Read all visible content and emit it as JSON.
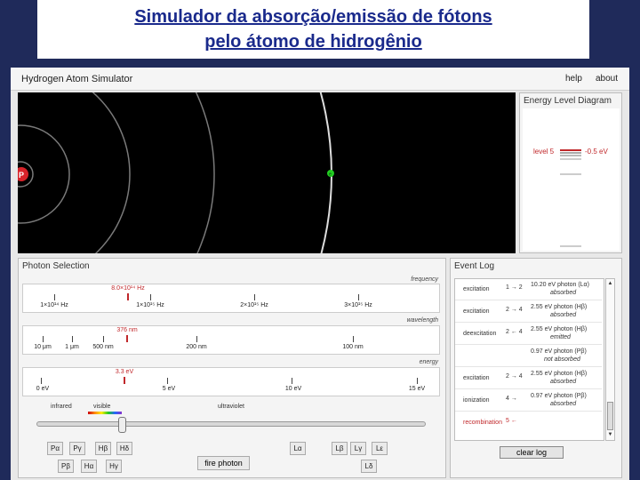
{
  "slide": {
    "title_line1": "Simulador da absorção/emissão de fótons",
    "title_line2": "pelo átomo de hidrogênio"
  },
  "app": {
    "title": "Hydrogen Atom Simulator",
    "help": "help",
    "about": "about"
  },
  "atom": {
    "proton_label": "P",
    "electron_label": "e"
  },
  "energy_diagram": {
    "title": "Energy Level Diagram",
    "level_label": "level 5",
    "energy_value": "-0.5 eV"
  },
  "photon_selection": {
    "title": "Photon Selection",
    "frequency": {
      "caption": "frequency",
      "selected_label": "8.0×10¹⁴ Hz",
      "ticks": [
        "1×10¹⁴ Hz",
        "1×10¹⁵ Hz",
        "2×10¹⁵ Hz",
        "3×10¹⁵ Hz"
      ]
    },
    "wavelength": {
      "caption": "wavelength",
      "selected_label": "376 nm",
      "ticks": [
        "10 μm",
        "1 μm",
        "500 nm",
        "200 nm",
        "100 nm"
      ]
    },
    "energy": {
      "caption": "energy",
      "selected_label": "3.3 eV",
      "ticks": [
        "0 eV",
        "5 eV",
        "10 eV",
        "15 eV"
      ]
    },
    "regions": {
      "infrared": "infrared",
      "visible": "visible",
      "ultraviolet": "ultraviolet"
    },
    "slider_fraction": 0.22,
    "lines": [
      "Pα",
      "Pγ",
      "Hβ",
      "Hδ",
      "Pβ",
      "Hα",
      "Hγ",
      "Lα",
      "Lβ",
      "Lγ",
      "Lε",
      "Lδ"
    ],
    "fire_button": "fire photon"
  },
  "event_log": {
    "title": "Event Log",
    "rows": [
      {
        "kind": "excitation",
        "transition": "1 → 2",
        "photon": "10.20 eV photon (Lα)",
        "status": "absorbed"
      },
      {
        "kind": "excitation",
        "transition": "2 → 4",
        "photon": "2.55 eV photon (Hβ)",
        "status": "absorbed"
      },
      {
        "kind": "deexcitation",
        "transition": "2 ← 4",
        "photon": "2.55 eV photon (Hβ)",
        "status": "emitted"
      },
      {
        "kind": "",
        "transition": "",
        "photon": "0.97 eV photon (Pβ)",
        "status": "not absorbed"
      },
      {
        "kind": "excitation",
        "transition": "2 → 4",
        "photon": "2.55 eV photon (Hβ)",
        "status": "absorbed"
      },
      {
        "kind": "ionization",
        "transition": "4 →",
        "photon": "0.97 eV photon (Pβ)",
        "status": "absorbed"
      },
      {
        "kind": "recombination",
        "transition": "5 ←",
        "photon": "",
        "status": ""
      }
    ],
    "clear_button": "clear log"
  },
  "colors": {
    "slide_bg": "#1f2a5a",
    "title_text": "#1a2a8c",
    "marker_red": "#c0282b",
    "electron_green": "#22cc22",
    "proton_red": "#d9232a"
  }
}
